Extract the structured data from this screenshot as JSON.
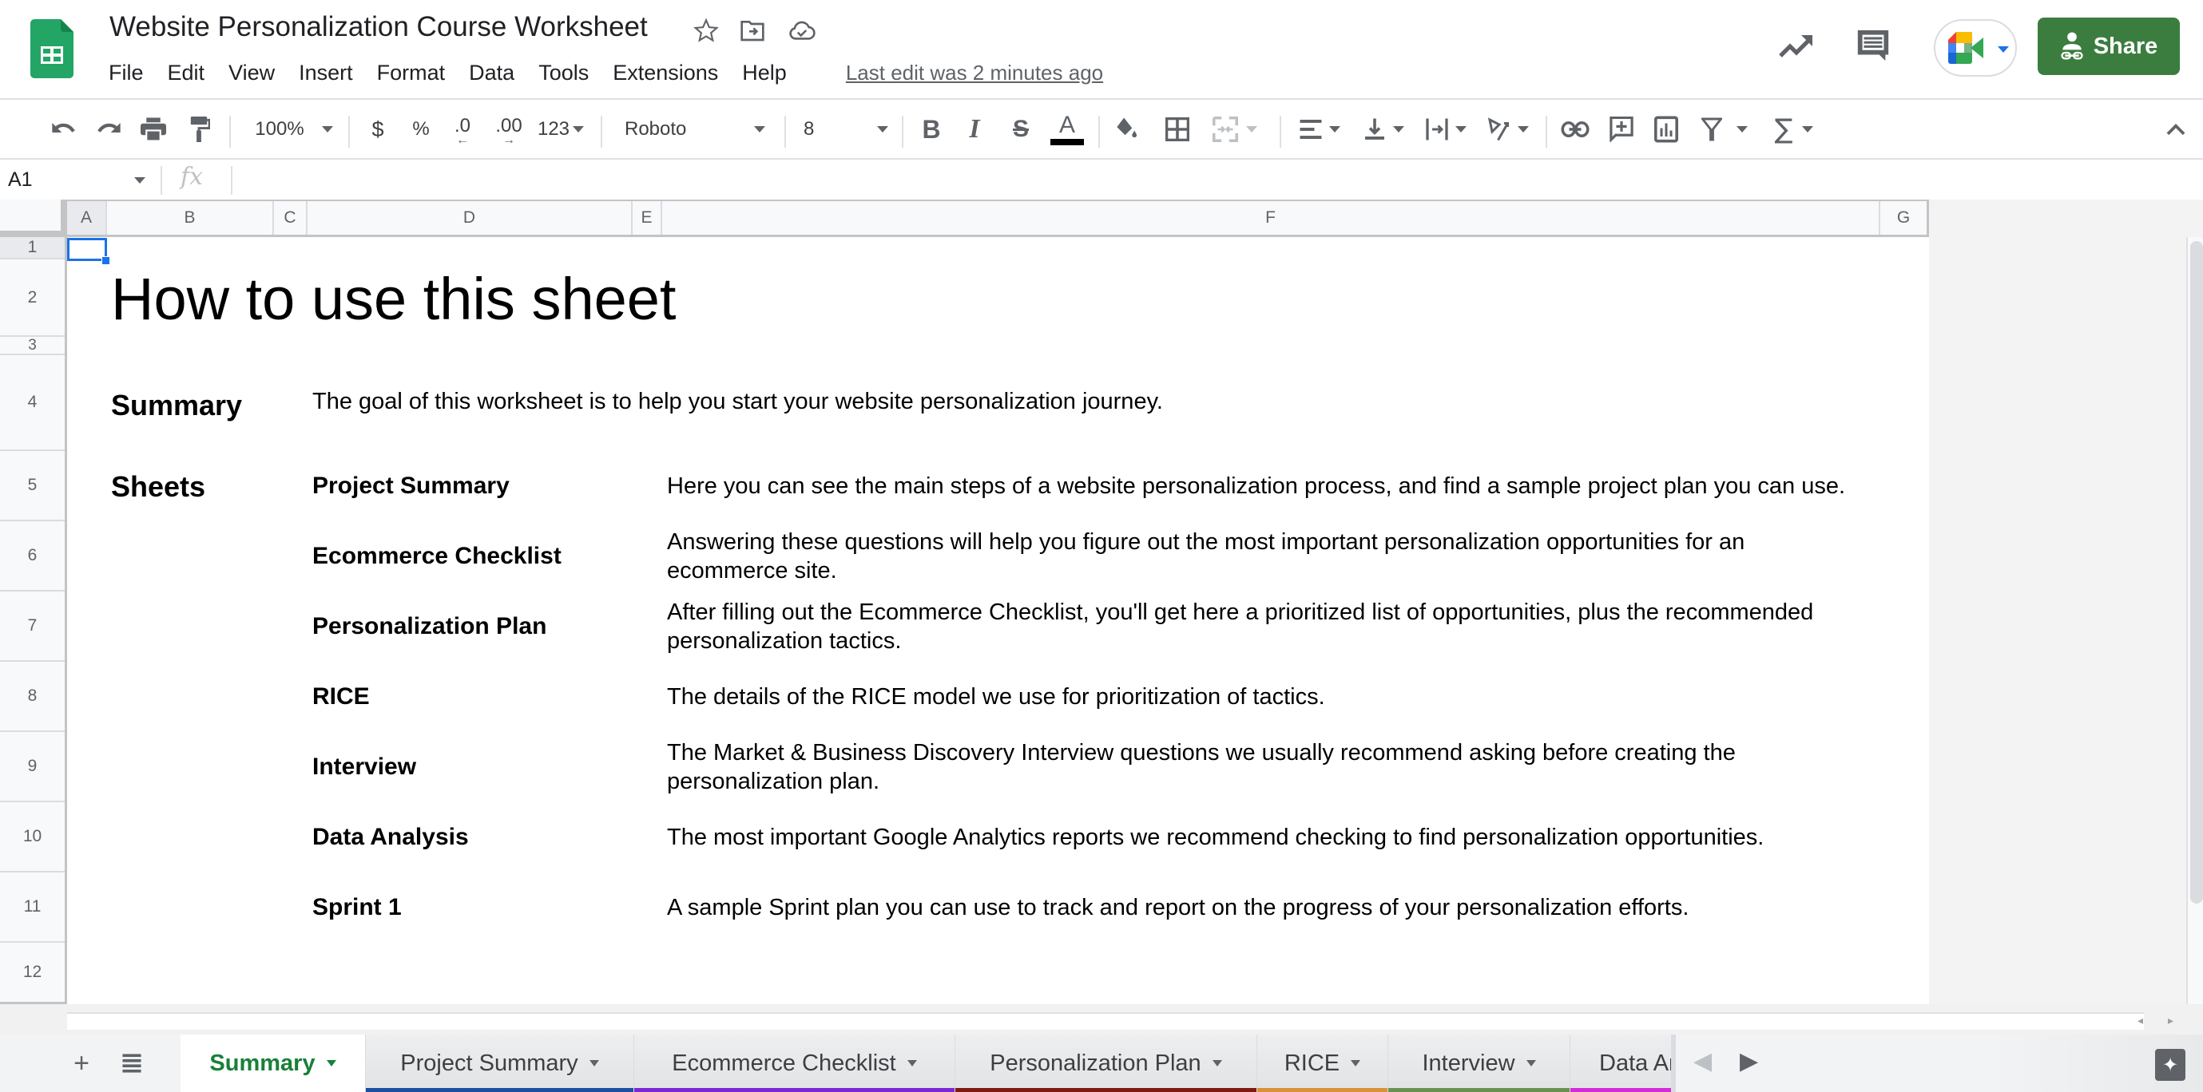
{
  "app": {
    "title": "Website Personalization Course Worksheet",
    "last_edit": "Last edit was 2 minutes ago",
    "share_label": "Share",
    "brand_color": "#188038",
    "share_color": "#3b7d3f"
  },
  "menu": [
    "File",
    "Edit",
    "View",
    "Insert",
    "Format",
    "Data",
    "Tools",
    "Extensions",
    "Help"
  ],
  "toolbar": {
    "zoom": "100%",
    "currency": "$",
    "percent": "%",
    "decrease_decimal": ".0",
    "increase_decimal": ".00",
    "more_formats": "123",
    "font": "Roboto",
    "font_size": "8",
    "text_color": "#000000"
  },
  "formula_bar": {
    "cell_ref": "A1",
    "fx_label": "fx",
    "value": ""
  },
  "columns": [
    "A",
    "B",
    "C",
    "D",
    "E",
    "F",
    "G"
  ],
  "rows": [
    "1",
    "2",
    "3",
    "4",
    "5",
    "6",
    "7",
    "8",
    "9",
    "10",
    "11",
    "12"
  ],
  "sheet": {
    "heading": "How to use this sheet",
    "summary_label": "Summary",
    "summary_text": "The goal of this worksheet is to help you start your website personalization journey.",
    "sheets_label": "Sheets",
    "entries": [
      {
        "name": "Project Summary",
        "description": "Here you can see the main steps of a website personalization process, and find a sample project plan you can use."
      },
      {
        "name": "Ecommerce Checklist",
        "description": "Answering these questions will help you figure out the most important personalization opportunities for an ecommerce site."
      },
      {
        "name": "Personalization Plan",
        "description": "After filling out the Ecommerce Checklist, you'll get here a prioritized list of opportunities, plus the recommended personalization tactics."
      },
      {
        "name": "RICE",
        "description": "The details of the RICE model we use for prioritization of tactics."
      },
      {
        "name": "Interview",
        "description": "The Market & Business Discovery Interview questions we usually recommend asking before creating the personalization plan."
      },
      {
        "name": "Data Analysis",
        "description": "The most important Google Analytics reports we recommend checking to find personalization opportunities."
      },
      {
        "name": "Sprint 1",
        "description": "A sample Sprint plan you can use to track and report on the progress of your personalization efforts."
      }
    ]
  },
  "tabs": [
    {
      "label": "Summary",
      "color": "#ffffff",
      "active": true
    },
    {
      "label": "Project Summary",
      "color": "#1c4fa0",
      "active": false
    },
    {
      "label": "Ecommerce Checklist",
      "color": "#7b28d4",
      "active": false
    },
    {
      "label": "Personalization Plan",
      "color": "#7f1a12",
      "active": false
    },
    {
      "label": "RICE",
      "color": "#d9913a",
      "active": false
    },
    {
      "label": "Interview",
      "color": "#6a9151",
      "active": false
    },
    {
      "label": "Data Analysis",
      "color": "#d22cd9",
      "active": false
    }
  ]
}
